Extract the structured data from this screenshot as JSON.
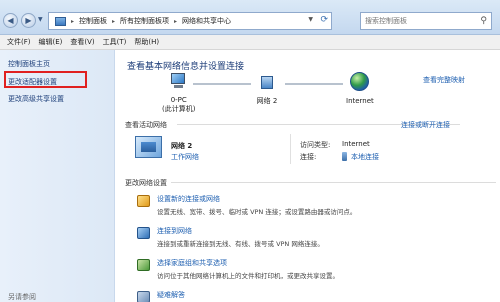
{
  "address": {
    "crumbs": [
      "控制面板",
      "所有控制面板项",
      "网络和共享中心"
    ],
    "search_placeholder": "搜索控制面板"
  },
  "menu": [
    "文件(F)",
    "编辑(E)",
    "查看(V)",
    "工具(T)",
    "帮助(H)"
  ],
  "sidebar": {
    "home": "控制面板主页",
    "adapter_settings": "更改适配器设置",
    "advanced_sharing": "更改高级共享设置",
    "bottom": "另请参阅"
  },
  "main": {
    "title": "查看基本网络信息并设置连接",
    "full_map": "查看完整映射",
    "map": {
      "pc_label": "0-PC",
      "pc_sub": "(此计算机)",
      "network_label": "网络  2",
      "internet_label": "Internet"
    },
    "active_section": "查看活动网络",
    "disconnect": "连接或断开连接",
    "active_network": {
      "name": "网络  2",
      "type": "工作网络",
      "access_key": "访问类型:",
      "access_value": "Internet",
      "conn_key": "连接:",
      "conn_value": "本地连接"
    },
    "change_section": "更改网络设置",
    "tasks": [
      {
        "title": "设置新的连接或网络",
        "desc": "设置无线、宽带、拨号、临时或 VPN 连接；或设置路由器或访问点。"
      },
      {
        "title": "连接到网络",
        "desc": "连接到或重新连接到无线、有线、拨号或 VPN 网络连接。"
      },
      {
        "title": "选择家庭组和共享选项",
        "desc": "访问位于其他网络计算机上的文件和打印机，或更改共享设置。"
      },
      {
        "title": "疑难解答",
        "desc": ""
      }
    ]
  },
  "colors": {
    "link": "#1e5fb0",
    "highlight_box": "#e02020",
    "sidebar_bg": "#dce8f6"
  }
}
